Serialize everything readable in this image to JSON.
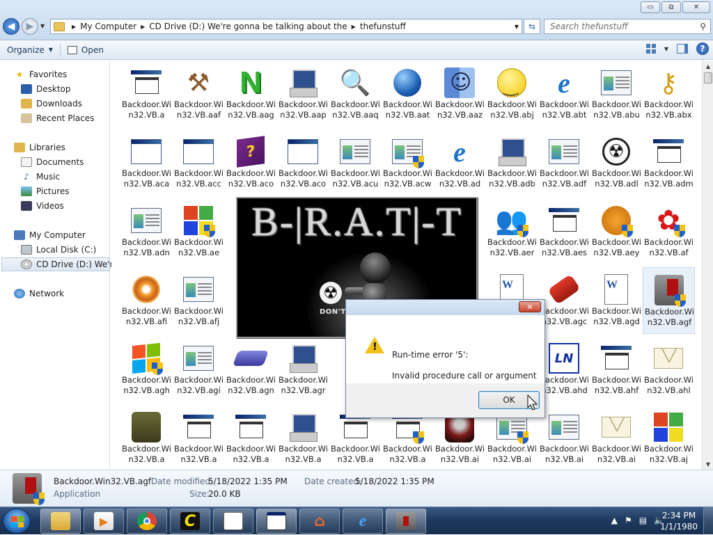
{
  "window": {
    "address_segments": [
      "My Computer",
      "CD Drive (D:) We're gonna be talking about the",
      "thefunstuff"
    ],
    "search_placeholder": "Search thefunstuff",
    "controls": {
      "minimize": "▭",
      "maximize": "⧉",
      "close": "✕"
    }
  },
  "toolbar": {
    "organize": "Organize",
    "open": "Open"
  },
  "navpane": {
    "favorites": {
      "label": "Favorites",
      "items": [
        "Desktop",
        "Downloads",
        "Recent Places"
      ]
    },
    "libraries": {
      "label": "Libraries",
      "items": [
        "Documents",
        "Music",
        "Pictures",
        "Videos"
      ]
    },
    "computer": {
      "label": "My Computer",
      "items": [
        "Local Disk (C:)",
        "CD Drive (D:) We're g"
      ]
    },
    "network": {
      "label": "Network"
    }
  },
  "files": [
    [
      "Backdoor.Win32.VB.a",
      "Backdoor.Win32.VB.aaf",
      "Backdoor.Win32.VB.aag",
      "Backdoor.Win32.VB.aap",
      "Backdoor.Win32.VB.aaq",
      "Backdoor.Win32.VB.aat",
      "Backdoor.Win32.VB.aaz",
      "Backdoor.Win32.VB.abj",
      "Backdoor.Win32.VB.abt",
      "Backdoor.Win32.VB.abu",
      "Backdoor.Win32.VB.abx"
    ],
    [
      "Backdoor.Win32.VB.aca",
      "Backdoor.Win32.VB.acc",
      "Backdoor.Win32.VB.aco",
      "Backdoor.Win32.VB.aco",
      "Backdoor.Win32.VB.acu",
      "Backdoor.Win32.VB.acw",
      "Backdoor.Win32.VB.ad",
      "Backdoor.Win32.VB.adb",
      "Backdoor.Win32.VB.adf",
      "Backdoor.Win32.VB.adl",
      "Backdoor.Win32.VB.adm"
    ],
    [
      "Backdoor.Win32.VB.adn",
      "Backdoor.Win32.VB.ae",
      "",
      "",
      "",
      "",
      "",
      "Backdoor.Win32.VB.aer",
      "Backdoor.Win32.VB.aes",
      "Backdoor.Win32.VB.aey",
      "Backdoor.Win32.VB.af"
    ],
    [
      "Backdoor.Win32.VB.afi",
      "Backdoor.Win32.VB.afj",
      "",
      "",
      "",
      "",
      "",
      "",
      "Backdoor.Win32.VB.agc",
      "Backdoor.Win32.VB.agd",
      "Backdoor.Win32.VB.agf"
    ],
    [
      "Backdoor.Win32.VB.agh",
      "Backdoor.Win32.VB.agi",
      "Backdoor.Win32.VB.agn",
      "Backdoor.Win32.VB.agr",
      "",
      "",
      "",
      "",
      "Backdoor.Win32.VB.ahd",
      "Backdoor.Win32.VB.ahf",
      "Backdoor.Win32.VB.ahl"
    ],
    [
      "Backdoor.Win32.VB.a",
      "Backdoor.Win32.VB.a",
      "Backdoor.Win32.VB.a",
      "Backdoor.Win32.VB.a",
      "Backdoor.Win32.VB.a",
      "Backdoor.Win32.VB.a",
      "Backdoor.Win32.VB.ai",
      "Backdoor.Win32.VB.ai",
      "Backdoor.Win32.VB.ai",
      "Backdoor.Win32.VB.ai",
      "Backdoor.Win32.VB.aj"
    ]
  ],
  "details": {
    "filename": "Backdoor.Win32.VB.agf",
    "type": "Application",
    "modified_label": "Date modified:",
    "modified_value": "5/18/2022 1:35 PM",
    "created_label": "Date created:",
    "created_value": "5/18/2022 1:35 PM",
    "size_label": "Size:",
    "size_value": "20.0 KB"
  },
  "splash": {
    "title": "B-|R.A.T|-T",
    "tagline": "DON'T PANIC"
  },
  "error_dialog": {
    "close": "✕",
    "line1": "Run-time error '5':",
    "line2": "Invalid procedure call or argument",
    "ok": "OK"
  },
  "taskbar": {
    "time": "2:34 PM",
    "date": "1/1/1980"
  }
}
